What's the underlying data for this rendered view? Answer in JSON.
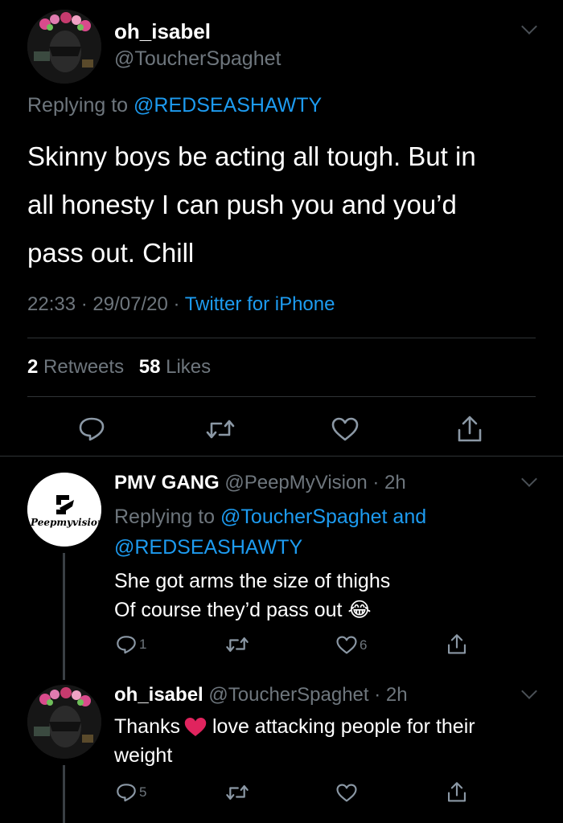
{
  "main_tweet": {
    "display_name": "oh_isabel",
    "handle": "@ToucherSpaghet",
    "replying_prefix": "Replying to",
    "replying_to": "@REDSEASHAWTY",
    "text_lines": [
      "Skinny boys be acting all tough. But in",
      "all honesty I can push you and you’d",
      "pass out. Chill"
    ],
    "time": "22:33",
    "date": "29/07/20",
    "client": "Twitter for iPhone",
    "retweets_count": "2",
    "retweets_label": "Retweets",
    "likes_count": "58",
    "likes_label": "Likes"
  },
  "reply1": {
    "display_name": "PMV GANG",
    "handle_time": "@PeepMyVision · 2h",
    "replying_prefix": "Replying to",
    "replying_to_1": "@ToucherSpaghet and",
    "replying_to_2": "@REDSEASHAWTY",
    "text_line1": "She got arms the size of thighs",
    "text_line2": "Of course they’d pass out 😂",
    "avatar_text": "Peepmyvision",
    "reply_count": "1",
    "like_count": "6"
  },
  "reply2": {
    "display_name": "oh_isabel",
    "handle_time": "@ToucherSpaghet · 2h",
    "text_line1_a": "Thanks",
    "text_line1_b": "love attacking people for their",
    "text_line2": "weight",
    "reply_count": "5"
  },
  "colors": {
    "background": "#000000",
    "muted": "#6e767d",
    "link": "#1d9bf0",
    "heart": "#e0245e"
  }
}
